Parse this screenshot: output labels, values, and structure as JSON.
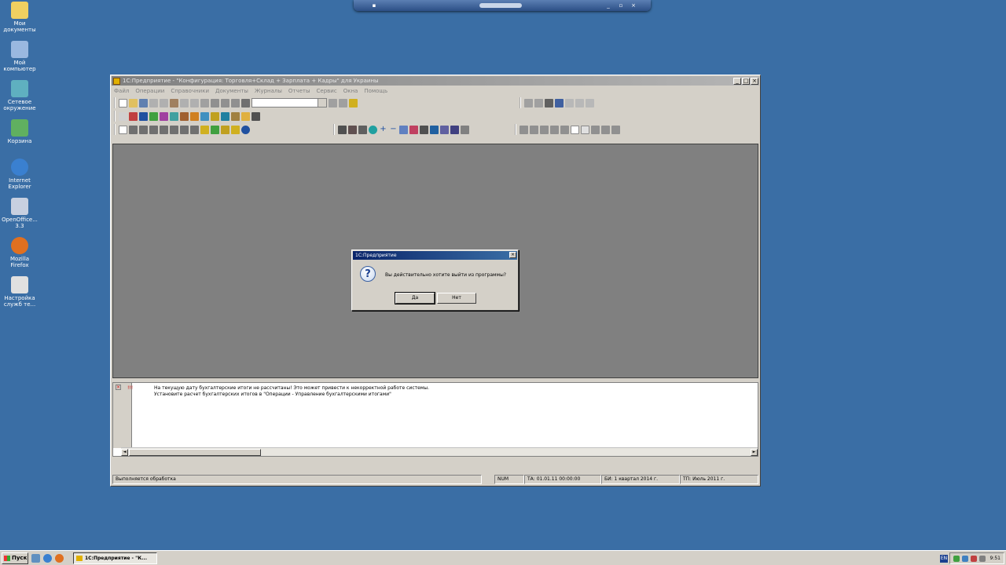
{
  "desktop_icons": [
    {
      "label": "Мои документы",
      "color": "#f0d060"
    },
    {
      "label": "Мой компьютер",
      "color": "#9ab8e0"
    },
    {
      "label": "Сетевое окружение",
      "color": "#5fb0c0"
    },
    {
      "label": "Корзина",
      "color": "#60b060"
    },
    {
      "label": "Internet Explorer",
      "color": "#3a80d0"
    },
    {
      "label": "OpenOffice... 3.3",
      "color": "#c8d0e0"
    },
    {
      "label": "Mozilla Firefox",
      "color": "#e07020"
    },
    {
      "label": "Настройка служб те...",
      "color": "#e0e0e0"
    }
  ],
  "window": {
    "title": "1С:Предприятие - \"Конфигурация: Торговля+Склад + Зарплата + Кадры\" для Украины"
  },
  "menu": [
    "Файл",
    "Операции",
    "Справочники",
    "Документы",
    "Журналы",
    "Отчеты",
    "Сервис",
    "Окна",
    "Помощь"
  ],
  "dialog": {
    "title": "1С:Предприятие",
    "message": "Вы действительно хотите выйти из программы?",
    "yes_label": "Да",
    "no_label": "Нет"
  },
  "messages": {
    "error_marker": "!!!",
    "line1": "На текущую дату бухгалтерские итоги не рассчитаны! Это может привести к некорректной работе системы.",
    "line2": "Установите расчет бухгалтерских итогов в \"Операции - Управление бухгалтерскими итогами\""
  },
  "status_bar": {
    "text": "Выполняется обработка",
    "num": "NUM",
    "ta": "ТА: 01.01.11 00:00:00",
    "bi": "БИ: 1 квартал 2014 г.",
    "tp": "ТП: Июль 2011 г."
  },
  "taskbar": {
    "start_label": "Пуск",
    "app_label": "1С:Предприятие - \"К...",
    "lang": "EN",
    "clock": "9:51"
  },
  "colors": {
    "desktop": "#3a6ea5",
    "workspace": "#808080",
    "window_face": "#d4d0c8",
    "dialog_title": "#0a246a"
  }
}
